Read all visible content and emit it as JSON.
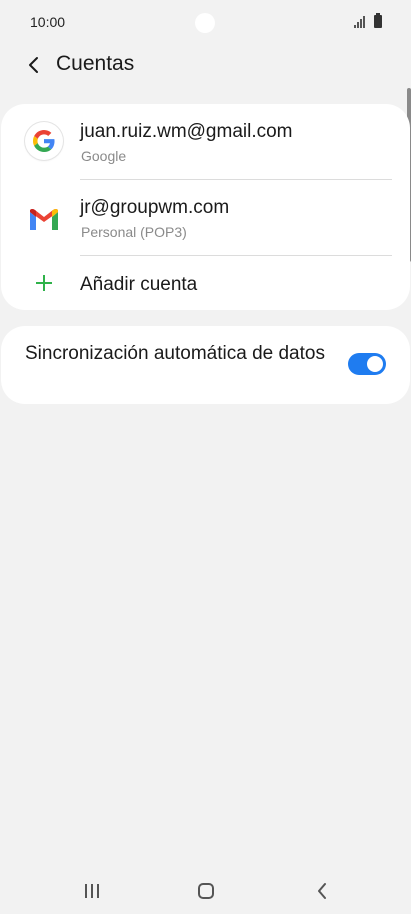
{
  "status_bar": {
    "time": "10:00",
    "icons": [
      "signal-icon",
      "battery-icon"
    ]
  },
  "header": {
    "title": "Cuentas",
    "back_icon": "chevron-left-icon"
  },
  "accounts": [
    {
      "title": "juan.ruiz.wm@gmail.com",
      "subtitle": "Google",
      "icon": "google-icon"
    },
    {
      "title": "jr@groupwm.com",
      "subtitle": "Personal (POP3)",
      "icon": "gmail-icon"
    }
  ],
  "add_account": {
    "label": "Añadir cuenta",
    "icon": "plus-icon",
    "color": "#2fb24a"
  },
  "sync": {
    "label": "Sincronización automática de datos",
    "enabled": true,
    "accent": "#1f7cf0"
  },
  "nav_bar": {
    "buttons": [
      "recents-icon",
      "home-icon",
      "back-icon"
    ]
  }
}
